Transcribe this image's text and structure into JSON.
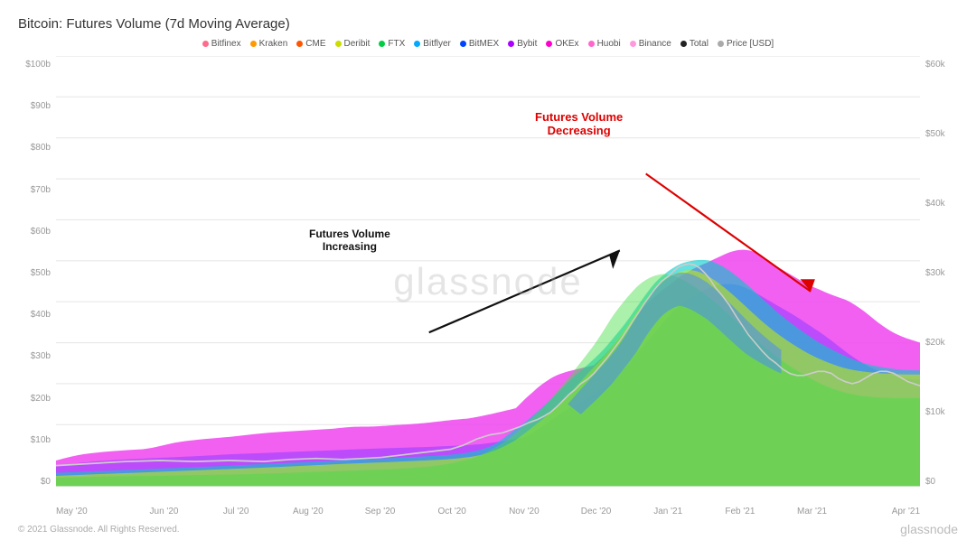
{
  "title": "Bitcoin: Futures Volume (7d Moving Average)",
  "legend": [
    {
      "label": "Bitfinex",
      "color": "#ff6b8a"
    },
    {
      "label": "Kraken",
      "color": "#ff9900"
    },
    {
      "label": "CME",
      "color": "#ff5500"
    },
    {
      "label": "Deribit",
      "color": "#ccdd00"
    },
    {
      "label": "FTX",
      "color": "#00cc44"
    },
    {
      "label": "Bitflyer",
      "color": "#00aaff"
    },
    {
      "label": "BitMEX",
      "color": "#0044ff"
    },
    {
      "label": "Bybit",
      "color": "#aa00ff"
    },
    {
      "label": "OKEx",
      "color": "#ff00cc"
    },
    {
      "label": "Huobi",
      "color": "#ff66cc"
    },
    {
      "label": "Binance",
      "color": "#ff99dd"
    },
    {
      "label": "Total",
      "color": "#222222"
    },
    {
      "label": "Price [USD]",
      "color": "#aaaaaa"
    }
  ],
  "yAxisLeft": [
    "$100b",
    "$90b",
    "$80b",
    "$70b",
    "$60b",
    "$50b",
    "$40b",
    "$30b",
    "$20b",
    "$10b",
    "$0"
  ],
  "yAxisRight": [
    "$60k",
    "$50k",
    "$40k",
    "$30k",
    "$20k",
    "$10k",
    "$0"
  ],
  "xLabels": [
    "May '20",
    "Jun '20",
    "Jul '20",
    "Aug '20",
    "Sep '20",
    "Oct '20",
    "Nov '20",
    "Dec '20",
    "Jan '21",
    "Feb '21",
    "Mar '21",
    "Apr '21"
  ],
  "annotations": {
    "increasing": "Futures Volume\nIncreasing",
    "decreasing": "Futures Volume\nDecreasing"
  },
  "watermark": "glassnode",
  "footer": {
    "copyright": "© 2021 Glassnode. All Rights Reserved.",
    "logo": "glassnode"
  }
}
